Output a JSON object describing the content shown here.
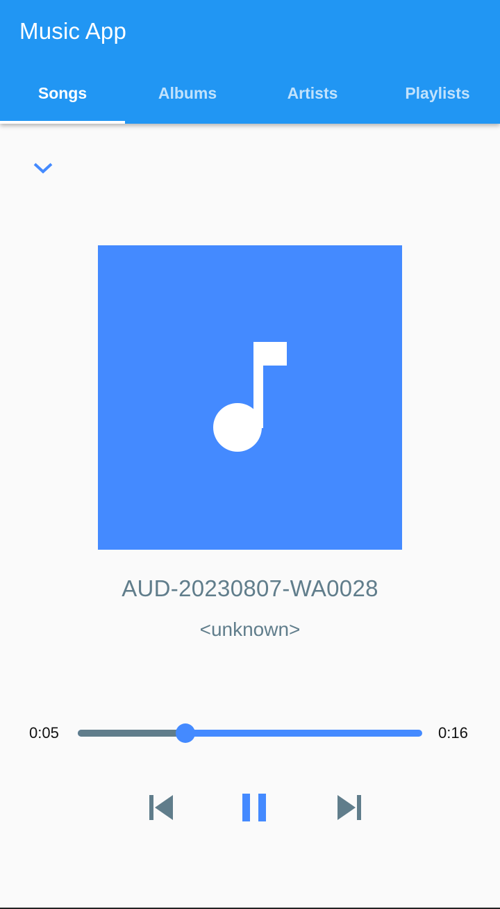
{
  "app": {
    "title": "Music App"
  },
  "tabs": [
    {
      "label": "Songs",
      "active": true
    },
    {
      "label": "Albums",
      "active": false
    },
    {
      "label": "Artists",
      "active": false
    },
    {
      "label": "Playlists",
      "active": false
    }
  ],
  "player": {
    "collapse_icon": "chevron-down-icon",
    "album_art_icon": "music-note-icon",
    "song_title": "AUD-20230807-WA0028",
    "artist": "<unknown>",
    "elapsed": "0:05",
    "duration": "0:16",
    "progress_fraction": 0.3125,
    "controls": {
      "previous_icon": "skip-previous-icon",
      "play_pause_icon": "pause-icon",
      "next_icon": "skip-next-icon"
    }
  },
  "colors": {
    "app_bar": "#2196f3",
    "accent": "#448aff",
    "secondary": "#607d8b",
    "background": "#fafafa"
  }
}
